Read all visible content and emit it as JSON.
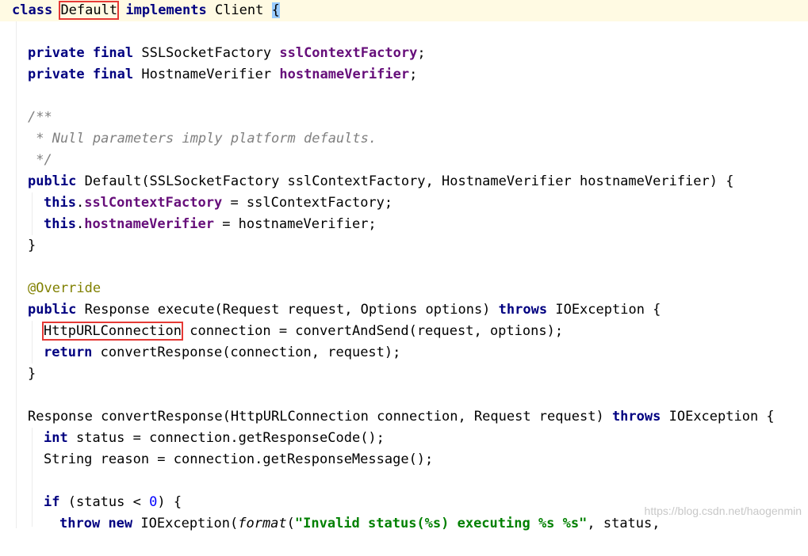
{
  "editor": {
    "line1": {
      "class_kw": "class",
      "class_name": "Default",
      "implements_kw": "implements",
      "interface": "Client",
      "brace": "{"
    },
    "line3": {
      "private_kw": "private",
      "final_kw": "final",
      "type": "SSLSocketFactory",
      "field": "sslContextFactory",
      "end": ";"
    },
    "line4": {
      "private_kw": "private",
      "final_kw": "final",
      "type": "HostnameVerifier",
      "field": "hostnameVerifier",
      "end": ";"
    },
    "line6": {
      "comment": "/**"
    },
    "line7": {
      "comment": " * Null parameters imply platform defaults."
    },
    "line8": {
      "comment": " */"
    },
    "line9": {
      "public_kw": "public",
      "rest": "Default(SSLSocketFactory sslContextFactory, HostnameVerifier hostnameVerifier) {"
    },
    "line10": {
      "this_kw": "this",
      "dot": ".",
      "field": "sslContextFactory",
      "rest": " = sslContextFactory;"
    },
    "line11": {
      "this_kw": "this",
      "dot": ".",
      "field": "hostnameVerifier",
      "rest": " = hostnameVerifier;"
    },
    "line12": {
      "text": "}"
    },
    "line14": {
      "annotation": "@Override"
    },
    "line15": {
      "public_kw": "public",
      "middle": "Response execute(Request request, Options options)",
      "throws_kw": "throws",
      "rest": "IOException {"
    },
    "line16": {
      "type": "HttpURLConnection",
      "rest": "connection = convertAndSend(request, options);"
    },
    "line17": {
      "return_kw": "return",
      "rest": "convertResponse(connection, request);"
    },
    "line18": {
      "text": "}"
    },
    "line20": {
      "middle": "Response convertResponse(HttpURLConnection connection, Request request)",
      "throws_kw": "throws",
      "rest": "IOException {"
    },
    "line21": {
      "int_kw": "int",
      "rest": "status = connection.getResponseCode();"
    },
    "line22": {
      "text": "String reason = connection.getResponseMessage();"
    },
    "line24": {
      "if_kw": "if",
      "pre": "(status < ",
      "num": "0",
      "post": ") {"
    },
    "line25": {
      "throw_kw": "throw",
      "new_kw": "new",
      "type": "IOException(",
      "fmt": "format",
      "paren": "(",
      "str": "\"Invalid status(%s) executing %s %s\"",
      "rest": ", status,"
    }
  },
  "watermark": "https://blog.csdn.net/haogenmin",
  "colors": {
    "keyword": "#000080",
    "field": "#660e7a",
    "comment": "#808080",
    "annotation": "#808000",
    "number": "#0000ff",
    "string": "#008000",
    "highlight_box": "#e53935",
    "current_line": "#fffae3"
  }
}
